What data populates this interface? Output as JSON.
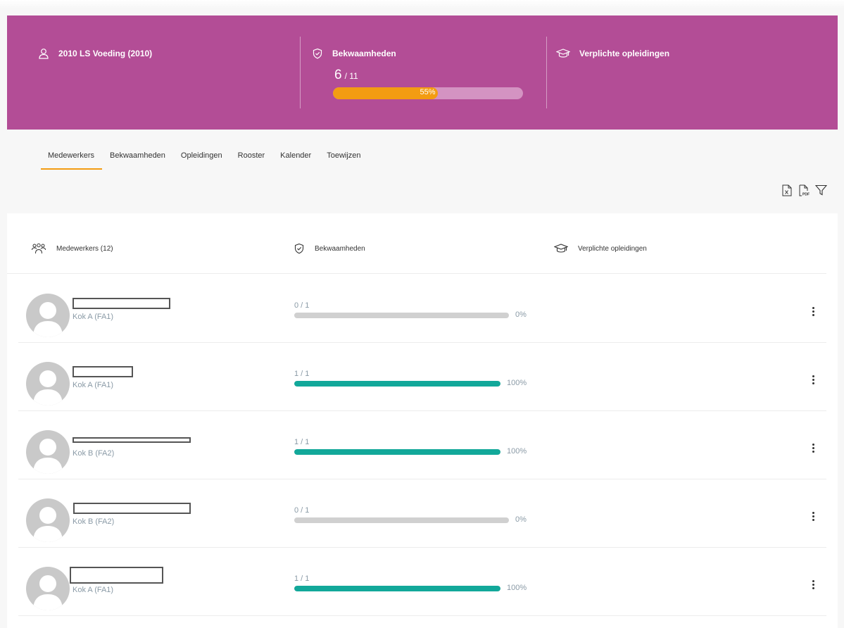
{
  "banner": {
    "location": "2010 LS Voeding (2010)",
    "competences": {
      "title": "Bekwaamheden",
      "achieved": "6",
      "total": "/ 11",
      "percent": 55,
      "percent_label": "55%"
    },
    "mandatory": {
      "title": "Verplichte opleidingen"
    },
    "colors": {
      "background": "#b34d96",
      "progress": "#f39c12",
      "track": "#d493c2"
    }
  },
  "tabs": [
    {
      "label": "Medewerkers",
      "active": true
    },
    {
      "label": "Bekwaamheden",
      "active": false
    },
    {
      "label": "Opleidingen",
      "active": false
    },
    {
      "label": "Rooster",
      "active": false
    },
    {
      "label": "Kalender",
      "active": false
    },
    {
      "label": "Toewijzen",
      "active": false
    }
  ],
  "toolbar": {
    "icons": [
      "excel-export-icon",
      "pdf-export-icon",
      "filter-icon"
    ]
  },
  "table": {
    "headers": {
      "employees": "Medewerkers (12)",
      "competences": "Bekwaamheden",
      "mandatory": "Verplichte opleidingen"
    },
    "rows": [
      {
        "role": "Kok A (FA1)",
        "ratio": "0 / 1",
        "percent": 0,
        "percent_label": "0%"
      },
      {
        "role": "Kok A (FA1)",
        "ratio": "1 / 1",
        "percent": 100,
        "percent_label": "100%"
      },
      {
        "role": "Kok B (FA2)",
        "ratio": "1 / 1",
        "percent": 100,
        "percent_label": "100%"
      },
      {
        "role": "Kok B (FA2)",
        "ratio": "0 / 1",
        "percent": 0,
        "percent_label": "0%"
      },
      {
        "role": "Kok A (FA1)",
        "ratio": "1 / 1",
        "percent": 100,
        "percent_label": "100%"
      }
    ],
    "colors": {
      "complete": "#12a89a",
      "track": "#d0d0d0"
    }
  }
}
